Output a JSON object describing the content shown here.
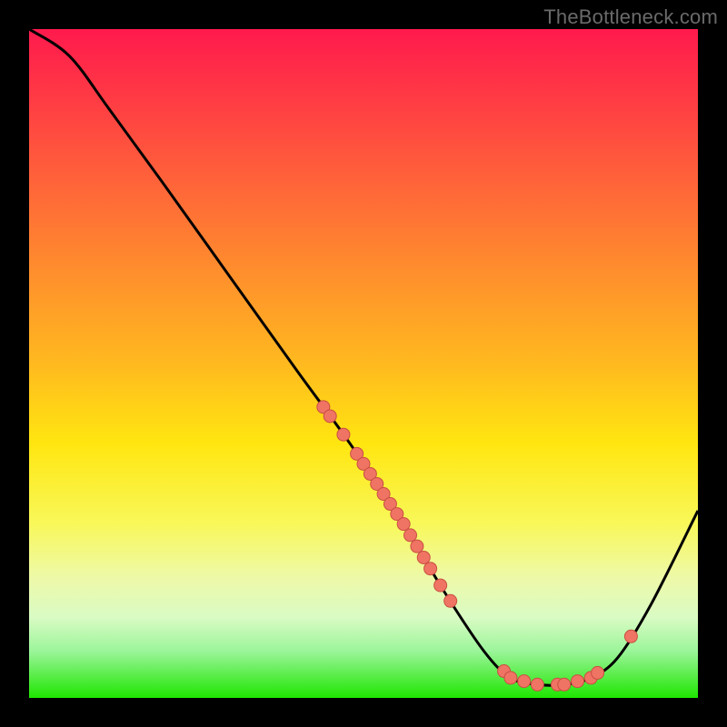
{
  "watermark": "TheBottleneck.com",
  "colors": {
    "curve": "#000000",
    "dot_fill": "#f07464",
    "dot_stroke": "#c94f42",
    "bg_black": "#000000"
  },
  "chart_data": {
    "type": "line",
    "title": "",
    "xlabel": "",
    "ylabel": "",
    "xlim": [
      0,
      100
    ],
    "ylim": [
      0,
      100
    ],
    "note": "Decorative bottleneck curve watermark; no axes or tick labels rendered. Y maps top=100 (worst, red) to bottom=0 (best, green). Curve path given; dot markers overlaid at arbitrary sample x-positions along the curve.",
    "curve_points": [
      {
        "x": 0,
        "y": 100
      },
      {
        "x": 6,
        "y": 96
      },
      {
        "x": 12,
        "y": 88
      },
      {
        "x": 20,
        "y": 77
      },
      {
        "x": 30,
        "y": 63
      },
      {
        "x": 40,
        "y": 49
      },
      {
        "x": 48,
        "y": 38
      },
      {
        "x": 56,
        "y": 26
      },
      {
        "x": 62,
        "y": 16
      },
      {
        "x": 68,
        "y": 7
      },
      {
        "x": 72,
        "y": 3
      },
      {
        "x": 76,
        "y": 2
      },
      {
        "x": 80,
        "y": 2
      },
      {
        "x": 84,
        "y": 3
      },
      {
        "x": 88,
        "y": 6
      },
      {
        "x": 93,
        "y": 14
      },
      {
        "x": 100,
        "y": 28
      }
    ],
    "dot_x_positions": [
      44,
      45,
      47,
      49,
      50,
      51,
      52,
      53,
      54,
      55,
      56,
      57,
      58,
      59,
      60,
      61.5,
      63,
      71,
      72,
      74,
      76,
      79,
      80,
      82,
      84,
      85,
      90
    ],
    "dot_radius": 7
  }
}
